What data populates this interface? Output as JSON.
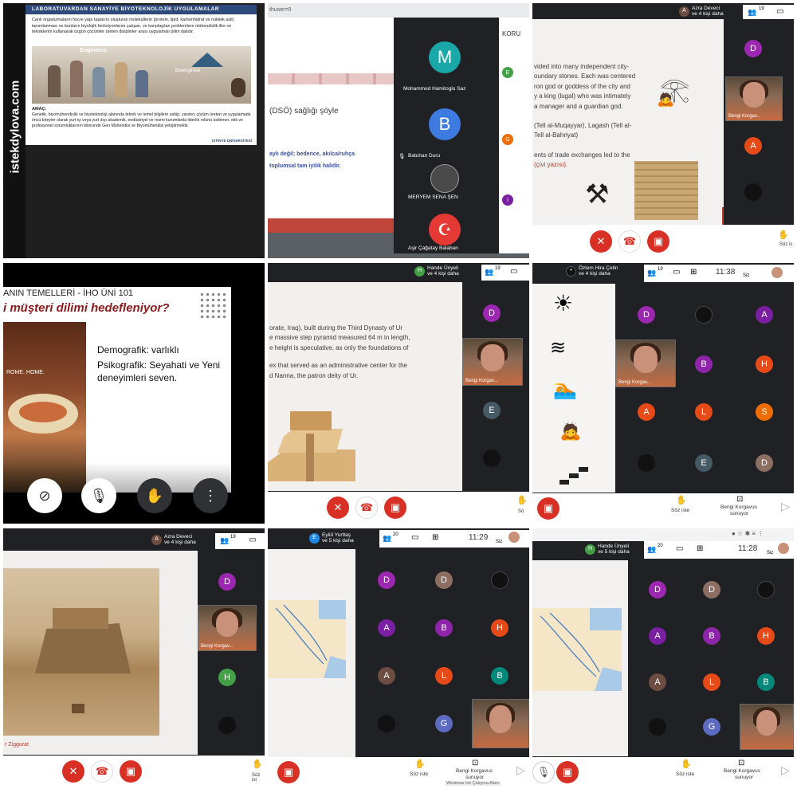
{
  "side_watermark": "istekdylova.com",
  "tile1": {
    "header": "LABORATUVARDAN SANAYİYE BİYOTEKNOLOJİK UYGULAMALAR",
    "body": "Canlı organizmaların hücre yapı taşlarını oluşturan moleküllerin (protein, lipid, karbonhidrat ve nükleik asit) tanımlanması ve bunların biyolojik fonksiyonlarını çalışan, ve karşılaşılan problemlere mühendislik ilke ve tekniklerini kullanarak özgün çözümler üreten disiplinler arası uygulamalı bilim dalıdır.",
    "engineers": "Engineers",
    "bioengineer": "Bioengineer",
    "amac_label": "AMAÇ:",
    "amac": "Genetik, biyomühendislik ve biyoteknoloji alanında teknik ve temel bilgilere sahip, yaratıcı çözüm üreten ve uygulamada öncü bireyler olarak yurt içi veya yurt dışı akademik, endüstriyel ve resmi kurumlarda liderlik rolünü üstlenen, etik ve profesyonel sorumluklarının bilincinde Gen Mühendisi ve Biyomühendisi yetiştirmektir.",
    "univ": "İSTİNYE ÜNİVERSİTESİ"
  },
  "tile2": {
    "url_frag": "thuser=0",
    "slide_frag1": "(DSÖ)   sağlığı   şöyle",
    "slide_frag2": "aylı değil; bedence, akılca/ruhça",
    "slide_frag3": "toplumsal tam iyilik halidir.",
    "panel_title": "KORU",
    "participants": [
      {
        "initial": "M",
        "name": "Mohammed Hamitoglu Saz",
        "color": "#1aa7a7"
      },
      {
        "initial": "B",
        "name": "Batuhan Duru",
        "color": "#3d7be0"
      },
      {
        "initial": "",
        "name": "MERYEM SENA ŞEN",
        "color": "#333"
      },
      {
        "initial": "",
        "name": "Aşir Çağatay Balaban",
        "color": "#e53935"
      }
    ],
    "side_initials": [
      "E",
      "G",
      "i"
    ]
  },
  "tile3": {
    "presenter": "Azra Deveci",
    "presenter_sub": "ve 4 kişi daha",
    "people_count": "19",
    "lines": [
      "vided into many independent city-",
      "oundary stones. Each was centered",
      "ron god or goddess of the city and",
      "y a king (lugal) who was intimately",
      "a manager and a guardian god.",
      "",
      "(Tell al-Muqayyar), Lagash (Tell al-",
      "Tell al-Bahriyat)",
      "",
      "ents of trade exchanges led to the",
      "(çivi yazısı)."
    ],
    "cam_name": "Bengi Korgav...",
    "tiles": [
      {
        "i": "D",
        "c": "#9c27b0"
      },
      {
        "i": "A",
        "c": "#e64a19"
      }
    ],
    "raise": "Söz is"
  },
  "tile4": {
    "course": "ANIN TEMELLERİ - İHO ÜNİ 101",
    "question": "i müşteri dilimi hedefleniyor?",
    "bullet1": "Demografik: varlıklı",
    "bullet2": "Psikografik: Seyahati ve Yeni deneyimleri seven.",
    "poster": "ROME. HOME."
  },
  "tile5": {
    "presenter": "Hande Ünyeli",
    "presenter_sub": "ve 4 kişi daha",
    "people_count": "19",
    "lines": [
      "orate, Iraq), built during the Third Dynasty of Ur",
      "e massive step pyramid measured 64 m in length,",
      "e height is speculative, as only the foundations of",
      "",
      "ex that served as an administrative center for the",
      "d Nanna, the patron deity of Ur."
    ],
    "cam_name": "Bengi Korgav...",
    "tiles": [
      {
        "i": "D",
        "c": "#9c27b0"
      },
      {
        "i": "E",
        "c": "#455a64"
      }
    ],
    "raise": "Sö"
  },
  "tile6": {
    "presenter": "Özlem Hira Çetin",
    "presenter_sub": "ve 4 kişi daha",
    "people_count": "19",
    "time": "11:38",
    "self_label": "Siz",
    "cam_name": "Bengi Korgav...",
    "tiles": [
      {
        "i": "D",
        "c": "#9c27b0"
      },
      {
        "i": "",
        "c": "#111"
      },
      {
        "i": "A",
        "c": "#7b1fa2"
      },
      {
        "i": "B",
        "c": "#8e24aa"
      },
      {
        "i": "H",
        "c": "#e64a19"
      },
      {
        "i": "A",
        "c": "#e64a19"
      },
      {
        "i": "L",
        "c": "#e64a19"
      },
      {
        "i": "S",
        "c": "#ef6c00"
      },
      {
        "i": "",
        "c": "#111"
      },
      {
        "i": "E",
        "c": "#455a64"
      },
      {
        "i": "D",
        "c": "#8d6e63"
      }
    ],
    "raise": "Söz iste",
    "presenting": "Bengi Korgavus",
    "presenting_sub": "sunuyor"
  },
  "tile7": {
    "presenter": "Azra Deveci",
    "presenter_sub": "ve 4 kişi daha",
    "people_count": "19",
    "caption": "r Ziggurat",
    "cam_name": "Bengi Korgav...",
    "tiles": [
      {
        "i": "D",
        "c": "#9c27b0"
      },
      {
        "i": "H",
        "c": "#43a047"
      }
    ],
    "raise": "Söz ist"
  },
  "tile8": {
    "presenter": "Eylül Yurttaş",
    "presenter_sub": "ve 5 kişi daha",
    "people_count": "20",
    "time": "11:29",
    "self_label": "Siz",
    "tiles": [
      {
        "i": "D",
        "c": "#9c27b0"
      },
      {
        "i": "D",
        "c": "#8d6e63"
      },
      {
        "i": "",
        "c": "#111"
      },
      {
        "i": "A",
        "c": "#7b1fa2"
      },
      {
        "i": "B",
        "c": "#8e24aa"
      },
      {
        "i": "H",
        "c": "#e64a19"
      },
      {
        "i": "A",
        "c": "#6d4c41"
      },
      {
        "i": "L",
        "c": "#e64a19"
      },
      {
        "i": "B",
        "c": "#00897b"
      },
      {
        "i": "",
        "c": "#111"
      },
      {
        "i": "G",
        "c": "#5c6bc0"
      }
    ],
    "raise": "Söz iste",
    "presenting": "Bengi Korgavus",
    "presenting_sub": "sunuyor",
    "windows_note": "Windows İnk Çalışma Alanı"
  },
  "tile9": {
    "presenter": "Hande Ünyeli",
    "presenter_sub": "ve 5 kişi daha",
    "people_count": "20",
    "time": "11:28",
    "self_label": "Siz",
    "tiles": [
      {
        "i": "D",
        "c": "#9c27b0"
      },
      {
        "i": "D",
        "c": "#8d6e63"
      },
      {
        "i": "",
        "c": "#111"
      },
      {
        "i": "A",
        "c": "#7b1fa2"
      },
      {
        "i": "B",
        "c": "#8e24aa"
      },
      {
        "i": "H",
        "c": "#e64a19"
      },
      {
        "i": "A",
        "c": "#6d4c41"
      },
      {
        "i": "L",
        "c": "#e64a19"
      },
      {
        "i": "B",
        "c": "#00897b"
      },
      {
        "i": "",
        "c": "#111"
      },
      {
        "i": "G",
        "c": "#5c6bc0"
      }
    ],
    "raise": "Söz iste",
    "presenting": "Bengi Korgavus",
    "presenting_sub": "sunuyor"
  }
}
